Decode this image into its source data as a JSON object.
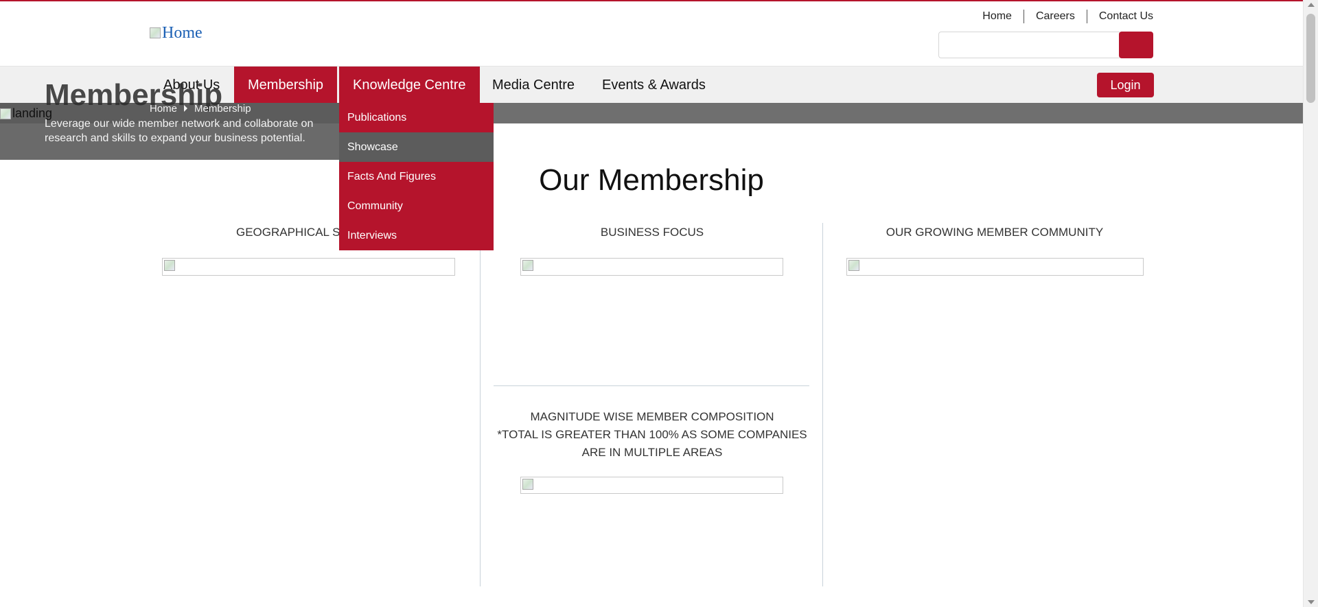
{
  "colors": {
    "brand": "#b5142c",
    "nav_bg": "#f0f0f0",
    "banner_gray": "#6f6f6f",
    "dropdown_hover": "#5c5c5c"
  },
  "header": {
    "logo_alt": "Home",
    "top_links": [
      {
        "label": "Home"
      },
      {
        "label": "Careers"
      },
      {
        "label": "Contact Us"
      }
    ],
    "search": {
      "placeholder": "",
      "button_icon": "search-icon"
    }
  },
  "nav": {
    "items": [
      {
        "label": "About Us",
        "active": false
      },
      {
        "label": "Membership",
        "active": true
      },
      {
        "label": "Knowledge Centre",
        "active": true
      },
      {
        "label": "Media Centre",
        "active": false
      },
      {
        "label": "Events & Awards",
        "active": false
      }
    ],
    "login_label": "Login"
  },
  "banner": {
    "image_alt": "landing",
    "title": "Membership",
    "description": "Leverage our wide member network and collaborate on research and skills to expand your business potential.",
    "breadcrumb": [
      "Home",
      "Membership"
    ]
  },
  "dropdown": {
    "items": [
      {
        "label": "Publications"
      },
      {
        "label": "Showcase",
        "hover": true
      },
      {
        "label": "Facts And Figures"
      },
      {
        "label": "Community"
      },
      {
        "label": "Interviews"
      }
    ]
  },
  "content": {
    "title": "Our Membership",
    "columns": [
      {
        "title": "GEOGRAPHICAL SPREAD"
      },
      {
        "title": "BUSINESS FOCUS"
      },
      {
        "title": "OUR GROWING MEMBER COMMUNITY"
      }
    ],
    "magnitude": {
      "line1": "MAGNITUDE WISE MEMBER COMPOSITION",
      "line2": "*TOTAL IS GREATER THAN 100% AS SOME COMPANIES",
      "line3": "ARE IN MULTIPLE AREAS"
    }
  }
}
